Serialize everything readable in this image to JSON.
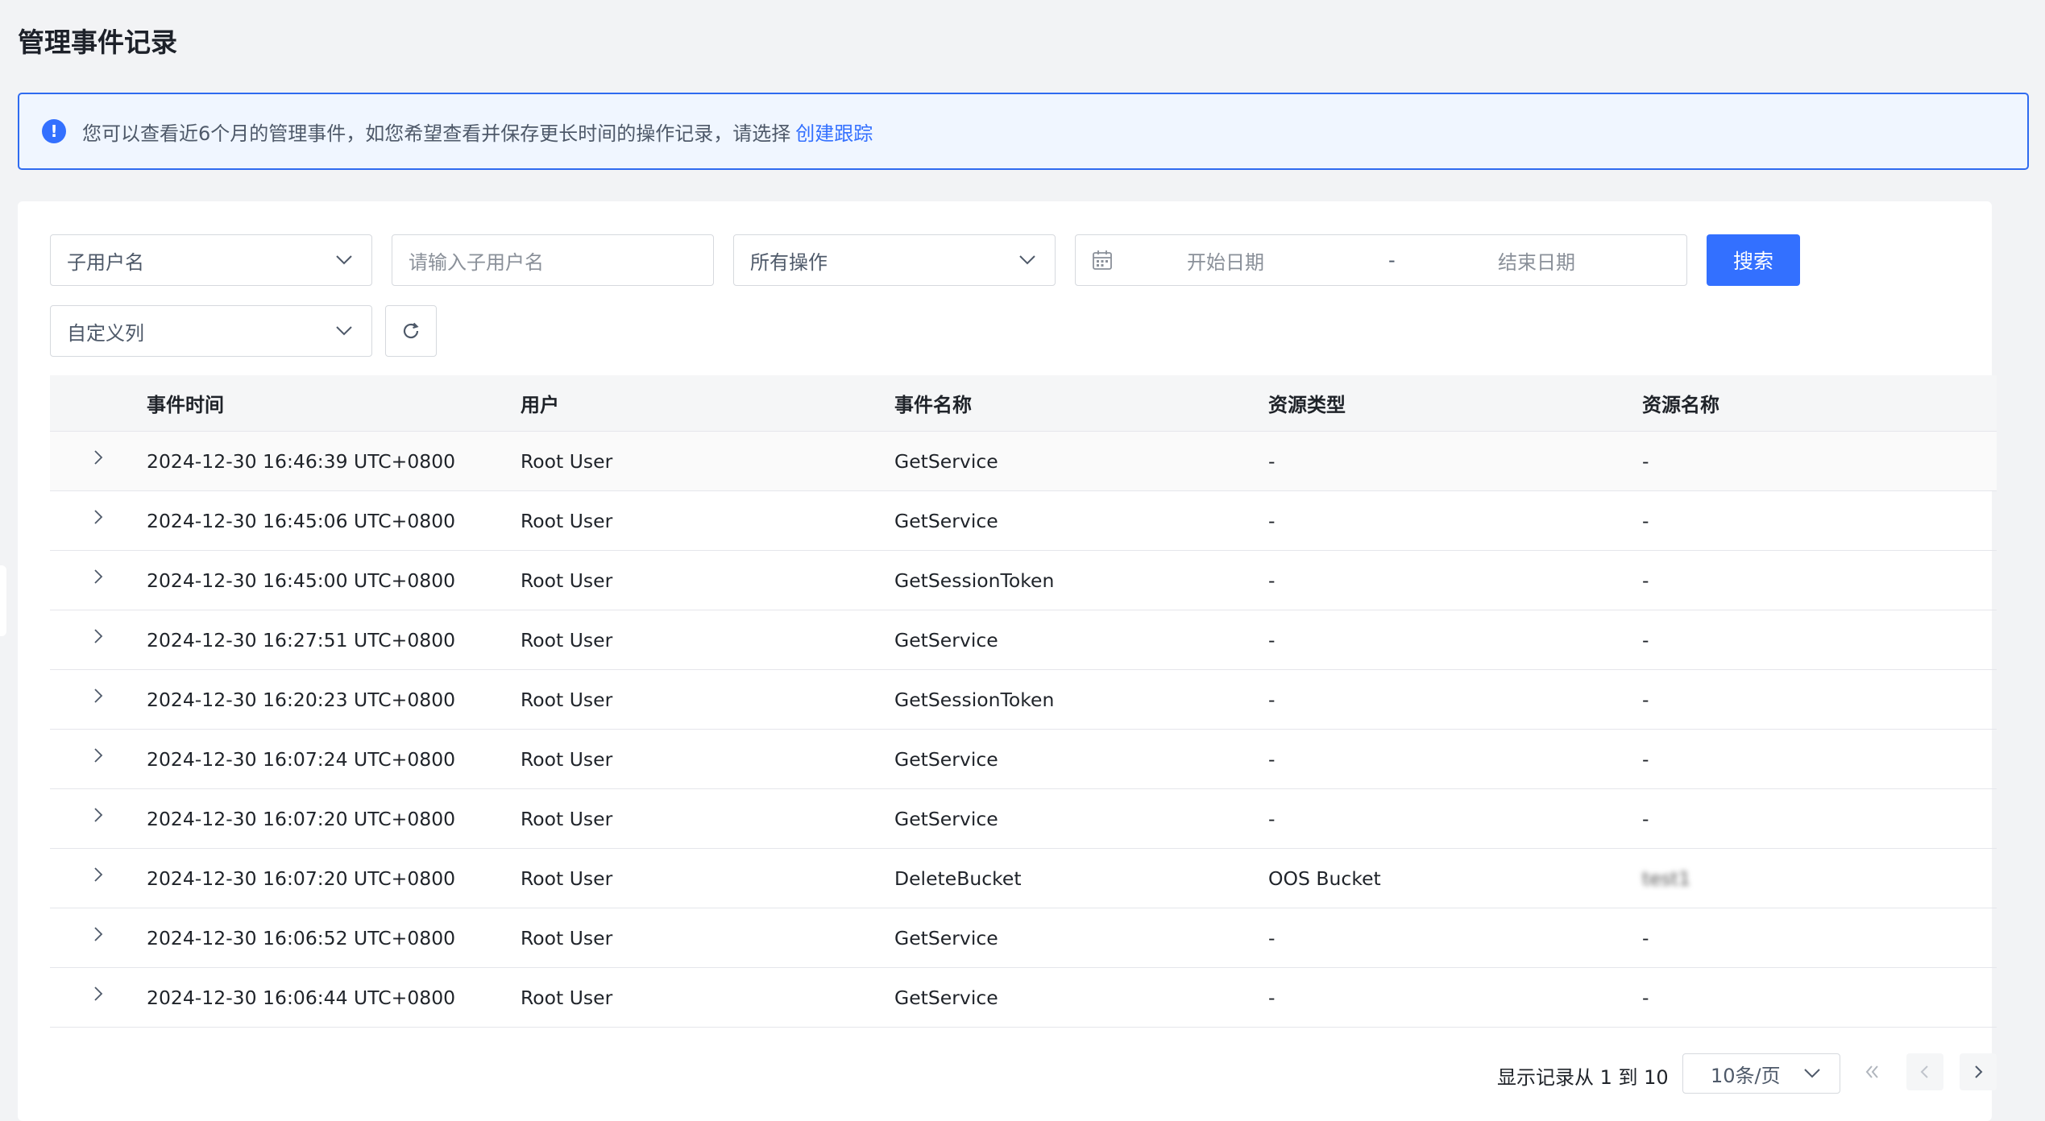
{
  "page": {
    "title": "管理事件记录"
  },
  "notice": {
    "text": "您可以查看近6个月的管理事件，如您希望查看并保存更长时间的操作记录，请选择",
    "link": "创建跟踪",
    "icon": "info-circle-icon"
  },
  "filters": {
    "user_type": "子用户名",
    "user_input_placeholder": "请输入子用户名",
    "operation": "所有操作",
    "start_date_placeholder": "开始日期",
    "date_separator": "-",
    "end_date_placeholder": "结束日期",
    "search_label": "搜索",
    "custom_columns": "自定义列"
  },
  "table": {
    "columns": [
      "事件时间",
      "用户",
      "事件名称",
      "资源类型",
      "资源名称"
    ],
    "rows": [
      {
        "time": "2024-12-30 16:46:39 UTC+0800",
        "user": "Root User",
        "event": "GetService",
        "resource_type": "-",
        "resource_name": "-"
      },
      {
        "time": "2024-12-30 16:45:06 UTC+0800",
        "user": "Root User",
        "event": "GetService",
        "resource_type": "-",
        "resource_name": "-"
      },
      {
        "time": "2024-12-30 16:45:00 UTC+0800",
        "user": "Root User",
        "event": "GetSessionToken",
        "resource_type": "-",
        "resource_name": "-"
      },
      {
        "time": "2024-12-30 16:27:51 UTC+0800",
        "user": "Root User",
        "event": "GetService",
        "resource_type": "-",
        "resource_name": "-"
      },
      {
        "time": "2024-12-30 16:20:23 UTC+0800",
        "user": "Root User",
        "event": "GetSessionToken",
        "resource_type": "-",
        "resource_name": "-"
      },
      {
        "time": "2024-12-30 16:07:24 UTC+0800",
        "user": "Root User",
        "event": "GetService",
        "resource_type": "-",
        "resource_name": "-"
      },
      {
        "time": "2024-12-30 16:07:20 UTC+0800",
        "user": "Root User",
        "event": "GetService",
        "resource_type": "-",
        "resource_name": "-"
      },
      {
        "time": "2024-12-30 16:07:20 UTC+0800",
        "user": "Root User",
        "event": "DeleteBucket",
        "resource_type": "OOS Bucket",
        "resource_name": "test1"
      },
      {
        "time": "2024-12-30 16:06:52 UTC+0800",
        "user": "Root User",
        "event": "GetService",
        "resource_type": "-",
        "resource_name": "-"
      },
      {
        "time": "2024-12-30 16:06:44 UTC+0800",
        "user": "Root User",
        "event": "GetService",
        "resource_type": "-",
        "resource_name": "-"
      }
    ]
  },
  "pagination": {
    "summary": "显示记录从 1 到 10",
    "page_size": "10条/页"
  },
  "colors": {
    "accent": "#3370ff",
    "notice_bg": "#f0f6ff",
    "border": "#d6d9de"
  }
}
